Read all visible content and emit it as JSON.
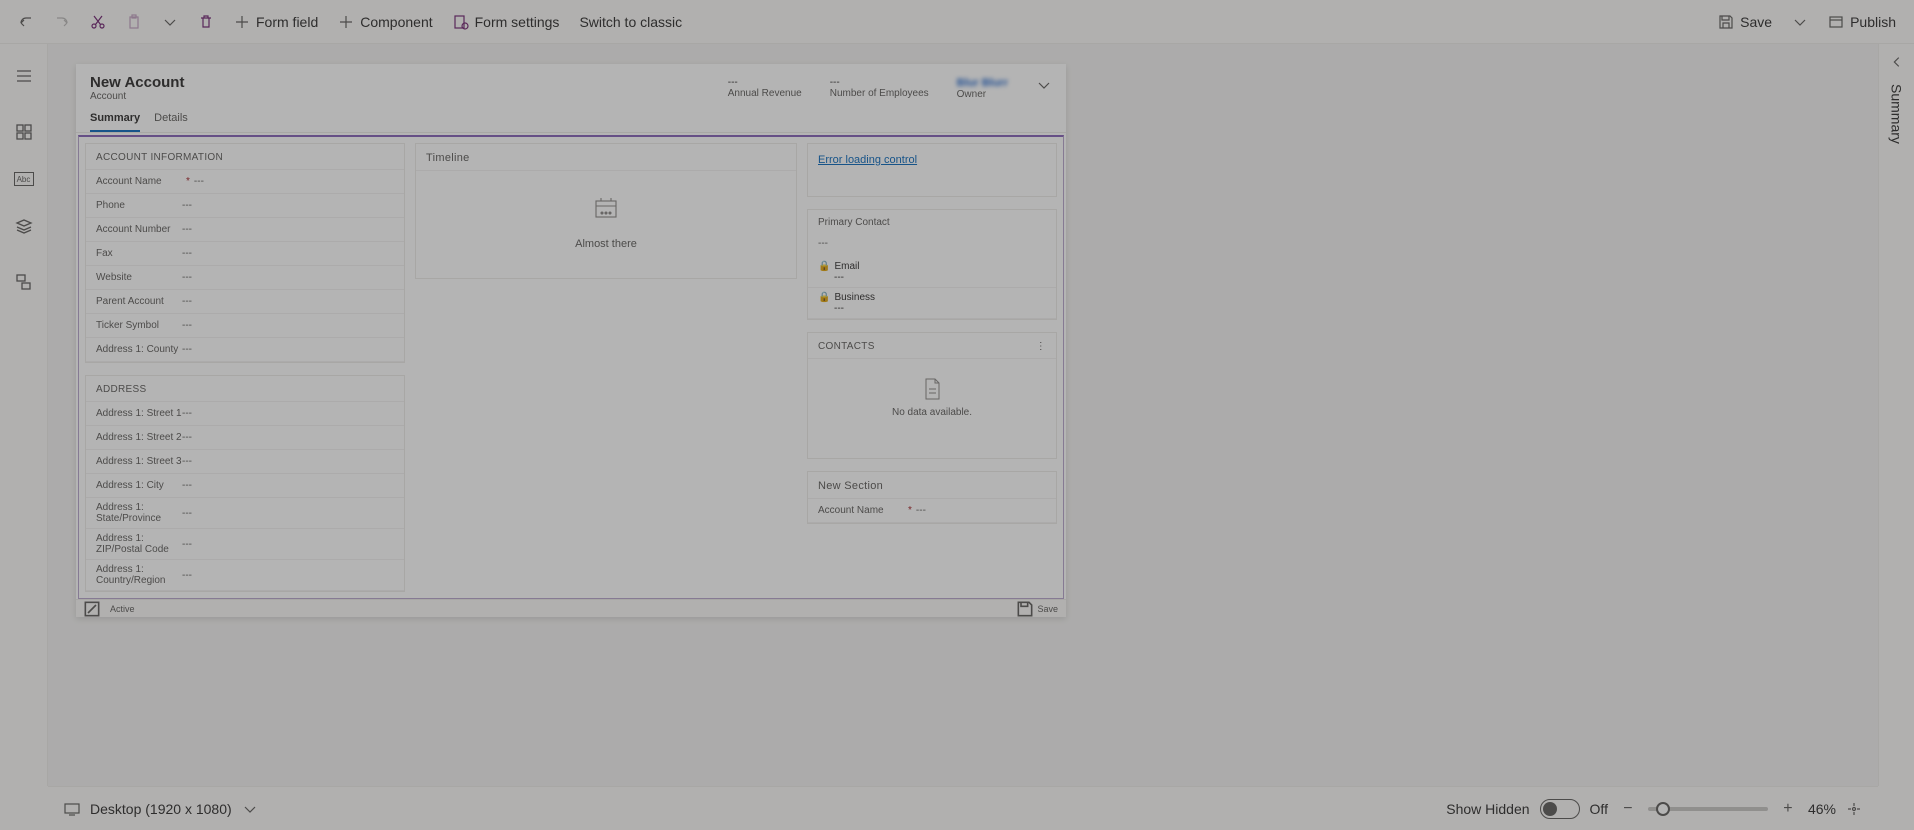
{
  "toolbar": {
    "undo": "Undo",
    "redo": "Redo",
    "cut": "Cut",
    "paste": "Paste",
    "delete": "Delete",
    "form_field": "Form field",
    "component": "Component",
    "form_settings": "Form settings",
    "switch_classic": "Switch to classic",
    "save": "Save",
    "publish": "Publish"
  },
  "right_panel": {
    "label": "Summary"
  },
  "footer": {
    "device": "Desktop (1920 x 1080)",
    "show_hidden_label": "Show Hidden",
    "show_hidden_state": "Off",
    "zoom": "46%"
  },
  "form": {
    "title": "New Account",
    "entity": "Account",
    "header_stats": [
      {
        "value": "---",
        "label": "Annual Revenue"
      },
      {
        "value": "---",
        "label": "Number of Employees"
      },
      {
        "value": "Blur Blurr",
        "label": "Owner"
      }
    ],
    "tabs": [
      "Summary",
      "Details"
    ],
    "active_tab": "Summary",
    "section_account_info": {
      "title": "ACCOUNT INFORMATION",
      "fields": [
        {
          "label": "Account Name",
          "required": true,
          "value": "---"
        },
        {
          "label": "Phone",
          "required": false,
          "value": "---"
        },
        {
          "label": "Account Number",
          "required": false,
          "value": "---"
        },
        {
          "label": "Fax",
          "required": false,
          "value": "---"
        },
        {
          "label": "Website",
          "required": false,
          "value": "---"
        },
        {
          "label": "Parent Account",
          "required": false,
          "value": "---"
        },
        {
          "label": "Ticker Symbol",
          "required": false,
          "value": "---"
        },
        {
          "label": "Address 1: County",
          "required": false,
          "value": "---"
        }
      ]
    },
    "section_address": {
      "title": "ADDRESS",
      "fields": [
        {
          "label": "Address 1: Street 1",
          "value": "---"
        },
        {
          "label": "Address 1: Street 2",
          "value": "---"
        },
        {
          "label": "Address 1: Street 3",
          "value": "---"
        },
        {
          "label": "Address 1: City",
          "value": "---"
        },
        {
          "label": "Address 1: State/Province",
          "value": "---"
        },
        {
          "label": "Address 1: ZIP/Postal Code",
          "value": "---"
        },
        {
          "label": "Address 1: Country/Region",
          "value": "---"
        }
      ]
    },
    "timeline": {
      "title": "Timeline",
      "message": "Almost there"
    },
    "right_col": {
      "error_link": "Error loading control",
      "primary_contact": {
        "title": "Primary Contact",
        "value": "---",
        "email_label": "Email",
        "email_value": "---",
        "business_label": "Business",
        "business_value": "---"
      },
      "contacts": {
        "title": "CONTACTS",
        "no_data": "No data available."
      },
      "new_section": {
        "title": "New Section",
        "field_label": "Account Name",
        "field_value": "---"
      }
    },
    "footer_status": "Active",
    "footer_save": "Save"
  }
}
